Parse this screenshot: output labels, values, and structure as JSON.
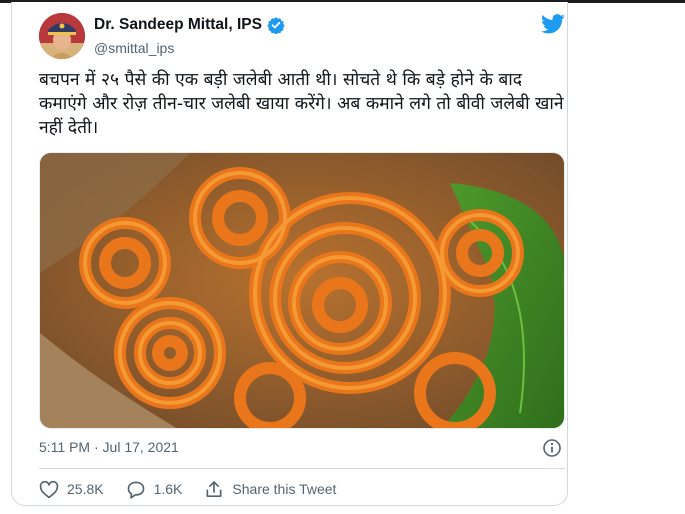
{
  "colors": {
    "accent": "#1d9bf0",
    "text": "#0f1419",
    "secondary": "#536471",
    "border": "#cfd9de"
  },
  "author": {
    "name": "Dr. Sandeep Mittal, IPS",
    "handle": "@smittal_ips",
    "verified_icon": "verified-badge-icon",
    "avatar_icon": "profile-avatar"
  },
  "brand_icon": "twitter-bird-icon",
  "tweet": {
    "text": "बचपन में २५ पैसे की एक बड़ी जलेबी आती थी। सोचते थे कि बड़े होने के बाद कमाएंगे और रोज़ तीन-चार जलेबी खाया करेंगे। अब कमाने लगे तो बीवी जलेबी खाने नहीं देती।",
    "media_icon": "jalebi-photo",
    "timestamp": "5:11 PM · Jul 17, 2021",
    "info_icon": "info-circle-icon"
  },
  "actions": {
    "likes": {
      "icon": "heart-icon",
      "count": "25.8K"
    },
    "replies": {
      "icon": "reply-bubble-icon",
      "count": "1.6K"
    },
    "share": {
      "icon": "share-icon",
      "label": "Share this Tweet"
    }
  }
}
